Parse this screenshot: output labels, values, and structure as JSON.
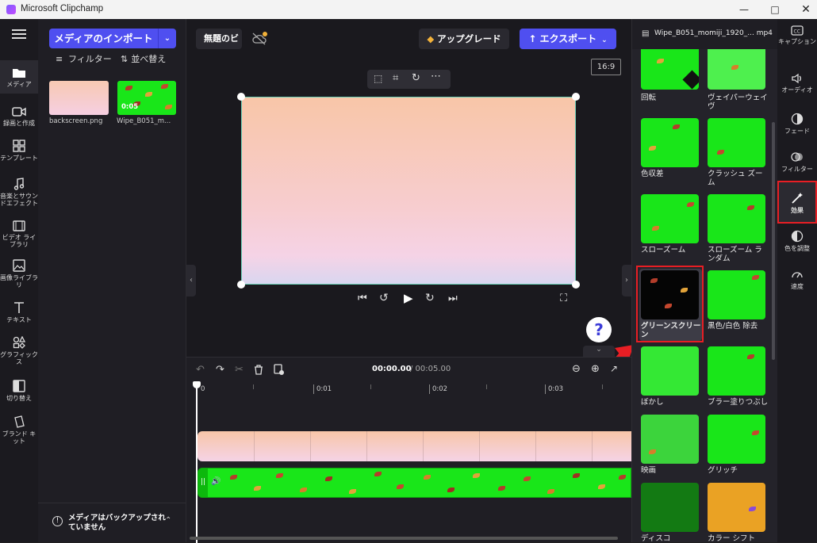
{
  "window": {
    "title": "Microsoft Clipchamp"
  },
  "left_nav": {
    "items": [
      {
        "label": "メディア"
      },
      {
        "label": "録画と作成"
      },
      {
        "label": "テンプレート"
      },
      {
        "label": "音楽とサウンドエフェクト"
      },
      {
        "label": "ビデオ ライブラリ"
      },
      {
        "label": "画像ライブラリ"
      },
      {
        "label": "テキスト"
      },
      {
        "label": "グラフィックス"
      },
      {
        "label": "切り替え"
      },
      {
        "label": "ブランド キット"
      }
    ]
  },
  "media": {
    "import_label": "メディアのインポート",
    "filter_label": "フィルター",
    "sort_label": "並べ替え",
    "items": [
      {
        "name": "backscreen.png"
      },
      {
        "name": "Wipe_B051_m...",
        "duration": "0:05"
      }
    ],
    "backup_notice": "メディアはバックアップされていません"
  },
  "toolbar": {
    "project_title": "無題のビ",
    "upgrade_label": "アップグレード",
    "export_label": "エクスポート",
    "aspect_ratio": "16:9"
  },
  "timeline": {
    "current_time": "00:00.00",
    "total_time": "/ 00:05.00",
    "ticks": [
      "0",
      "0:01",
      "0:02",
      "0:03"
    ]
  },
  "help": {
    "label": "?"
  },
  "effects_panel": {
    "file_name": "Wipe_B051_momiji_1920_... mp4",
    "effects": [
      {
        "label": "回転"
      },
      {
        "label": "ヴェイパーウェイヴ"
      },
      {
        "label": "色収差"
      },
      {
        "label": "クラッシュ ズーム"
      },
      {
        "label": "スローズーム"
      },
      {
        "label": "スローズーム ランダム"
      },
      {
        "label": "グリーンスクリーン"
      },
      {
        "label": "黒色/白色 除去"
      },
      {
        "label": "ぼかし"
      },
      {
        "label": "ブラー塗りつぶし"
      },
      {
        "label": "映画"
      },
      {
        "label": "グリッチ"
      },
      {
        "label": "ディスコ"
      },
      {
        "label": "カラー シフト"
      }
    ]
  },
  "right_nav": {
    "items": [
      {
        "label": "キャプション"
      },
      {
        "label": "オーディオ"
      },
      {
        "label": "フェード"
      },
      {
        "label": "フィルター"
      },
      {
        "label": "効果"
      },
      {
        "label": "色を調整"
      },
      {
        "label": "速度"
      }
    ]
  },
  "colors": {
    "accent": "#4f4ff0",
    "highlight": "#e81e24",
    "green": "#19e619"
  }
}
